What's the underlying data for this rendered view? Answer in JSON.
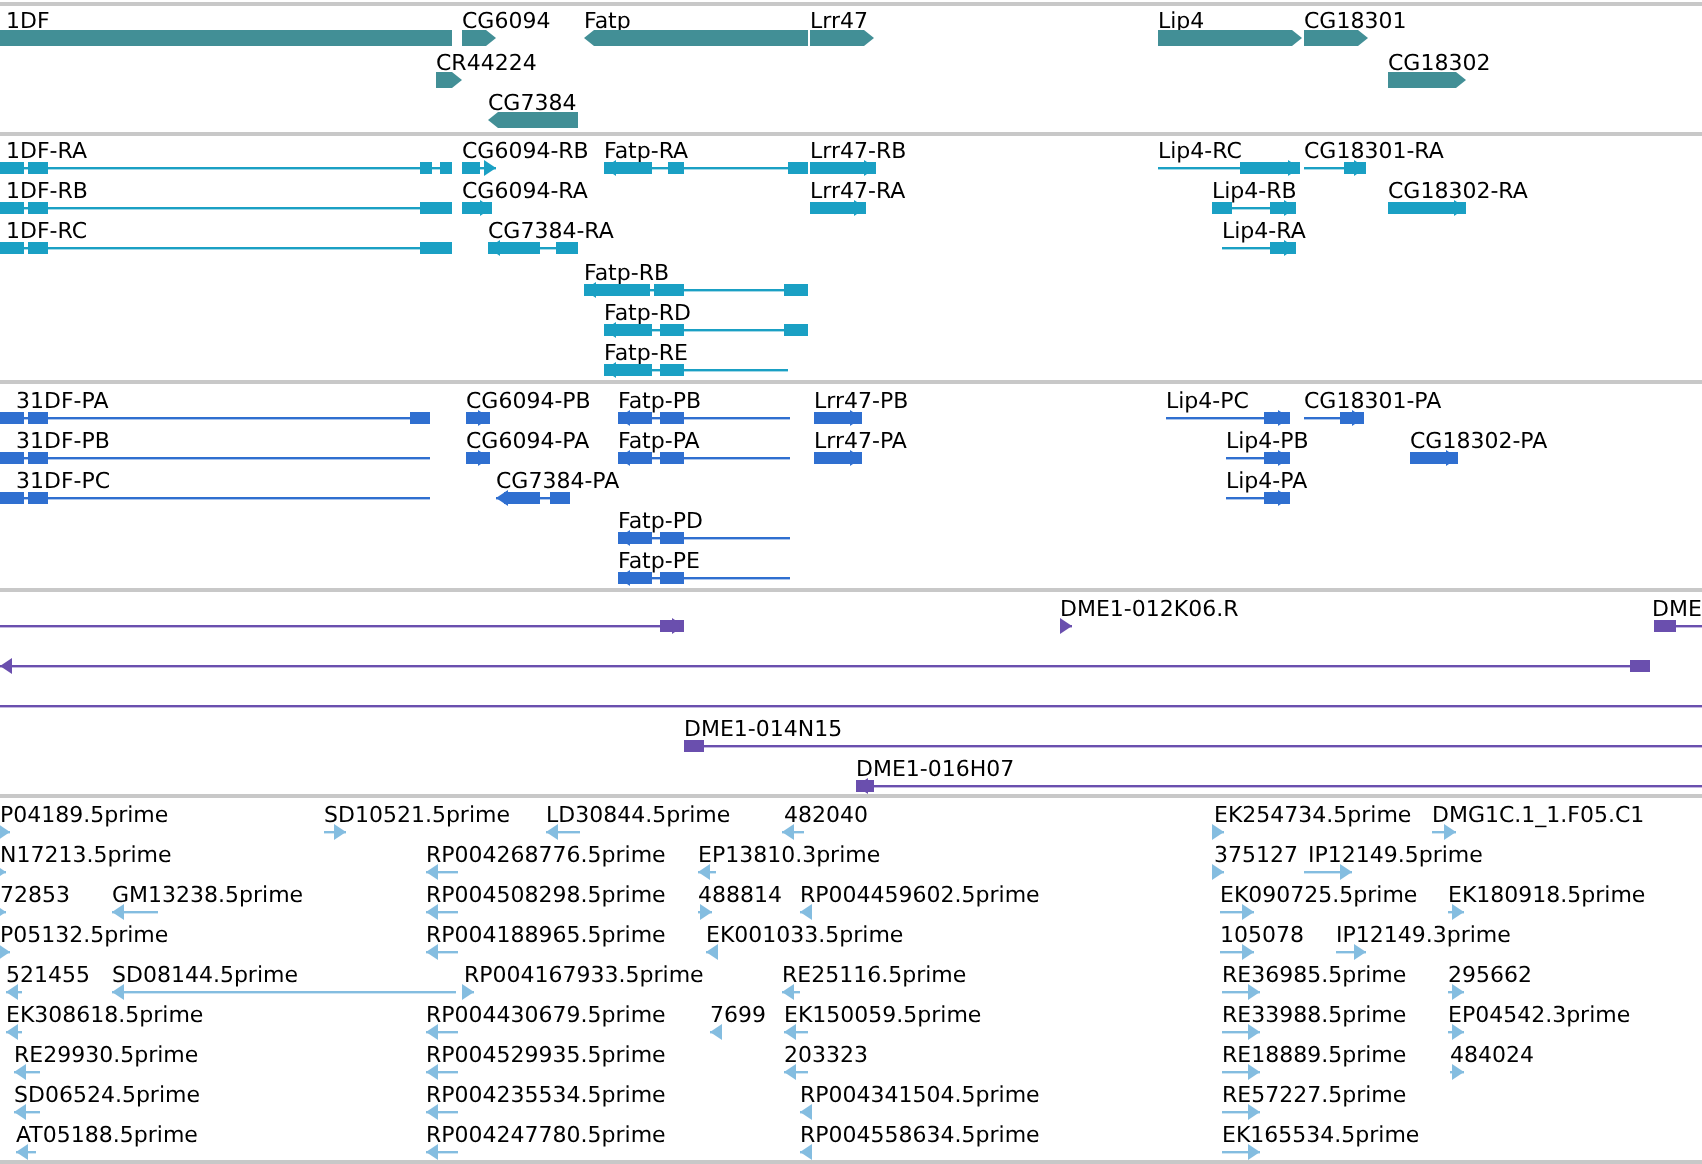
{
  "tracks": [
    {
      "kind": "gene",
      "color": "#428f96",
      "features": [
        {
          "label": "1DF",
          "reverse": true
        },
        {
          "label": "CG6094",
          "reverse": false
        },
        {
          "label": "Fatp",
          "reverse": true
        },
        {
          "label": "Lrr47",
          "reverse": false
        },
        {
          "label": "Lip4",
          "reverse": false
        },
        {
          "label": "CG18301",
          "reverse": false
        },
        {
          "label": "CR44224",
          "reverse": false
        },
        {
          "label": "CG18302",
          "reverse": false
        },
        {
          "label": "CG7384",
          "reverse": true
        }
      ]
    },
    {
      "kind": "transcript",
      "color": "#1aa0c4",
      "features": [
        {
          "label": "1DF-RA",
          "reverse": true
        },
        {
          "label": "CG6094-RB",
          "reverse": false
        },
        {
          "label": "Fatp-RA",
          "reverse": true
        },
        {
          "label": "Lrr47-RB",
          "reverse": false
        },
        {
          "label": "Lip4-RC",
          "reverse": false
        },
        {
          "label": "CG18301-RA",
          "reverse": false
        },
        {
          "label": "1DF-RB",
          "reverse": true
        },
        {
          "label": "CG6094-RA",
          "reverse": false
        },
        {
          "label": "Lrr47-RA",
          "reverse": false
        },
        {
          "label": "Lip4-RB",
          "reverse": false
        },
        {
          "label": "CG18302-RA",
          "reverse": false
        },
        {
          "label": "1DF-RC",
          "reverse": true
        },
        {
          "label": "CG7384-RA",
          "reverse": true
        },
        {
          "label": "Lip4-RA",
          "reverse": false
        },
        {
          "label": "Fatp-RB",
          "reverse": true
        },
        {
          "label": "Fatp-RD",
          "reverse": true
        },
        {
          "label": "Fatp-RE",
          "reverse": true
        }
      ]
    },
    {
      "kind": "protein",
      "color": "#2f6fd0",
      "features": [
        {
          "label": "31DF-PA",
          "reverse": true
        },
        {
          "label": "CG6094-PB",
          "reverse": false
        },
        {
          "label": "Fatp-PB",
          "reverse": true
        },
        {
          "label": "Lrr47-PB",
          "reverse": false
        },
        {
          "label": "Lip4-PC",
          "reverse": false
        },
        {
          "label": "CG18301-PA",
          "reverse": false
        },
        {
          "label": "31DF-PB",
          "reverse": true
        },
        {
          "label": "CG6094-PA",
          "reverse": false
        },
        {
          "label": "Fatp-PA",
          "reverse": true
        },
        {
          "label": "Lrr47-PA",
          "reverse": false
        },
        {
          "label": "Lip4-PB",
          "reverse": false
        },
        {
          "label": "CG18302-PA",
          "reverse": false
        },
        {
          "label": "31DF-PC",
          "reverse": true
        },
        {
          "label": "CG7384-PA",
          "reverse": true
        },
        {
          "label": "Lip4-PA",
          "reverse": false
        },
        {
          "label": "Fatp-PD",
          "reverse": true
        },
        {
          "label": "Fatp-PE",
          "reverse": true
        }
      ]
    },
    {
      "kind": "clone",
      "color": "#6a4fae",
      "features": [
        {
          "reverse": false
        },
        {
          "label": "DME1-012K06.R",
          "reverse": false
        },
        {
          "label": "DME",
          "reverse": false
        },
        {
          "reverse": true
        },
        {
          "reverse": false
        },
        {
          "label": "DME1-014N15",
          "reverse": false
        },
        {
          "label": "DME1-016H07",
          "reverse": true
        }
      ]
    },
    {
      "kind": "est",
      "color": "#84bde0",
      "features": [
        {
          "label": "P04189.5prime",
          "reverse": false
        },
        {
          "label": "SD10521.5prime",
          "reverse": false
        },
        {
          "label": "LD30844.5prime",
          "reverse": true
        },
        {
          "label": "482040",
          "reverse": true
        },
        {
          "label": "EK254734.5prime",
          "reverse": false
        },
        {
          "label": "DMG1C.1_1.F05.C1",
          "reverse": false
        },
        {
          "label": "N17213.5prime",
          "reverse": false
        },
        {
          "label": "RP004268776.5prime",
          "reverse": true
        },
        {
          "label": "EP13810.3prime",
          "reverse": true
        },
        {
          "label": "375127",
          "reverse": false
        },
        {
          "label": "IP12149.5prime",
          "reverse": false
        },
        {
          "label": "72853",
          "reverse": false
        },
        {
          "label": "GM13238.5prime",
          "reverse": true
        },
        {
          "label": "RP004508298.5prime",
          "reverse": true
        },
        {
          "label": "488814",
          "reverse": false
        },
        {
          "label": "RP004459602.5prime",
          "reverse": true
        },
        {
          "label": "EK090725.5prime",
          "reverse": false
        },
        {
          "label": "EK180918.5prime",
          "reverse": false
        },
        {
          "label": "P05132.5prime",
          "reverse": false
        },
        {
          "label": "RP004188965.5prime",
          "reverse": true
        },
        {
          "label": "EK001033.5prime",
          "reverse": true
        },
        {
          "label": "105078",
          "reverse": false
        },
        {
          "label": "IP12149.3prime",
          "reverse": false
        },
        {
          "label": "521455",
          "reverse": true
        },
        {
          "label": "SD08144.5prime",
          "reverse": true
        },
        {
          "label": "RP004167933.5prime",
          "reverse": false
        },
        {
          "label": "RE25116.5prime",
          "reverse": true
        },
        {
          "label": "RE36985.5prime",
          "reverse": false
        },
        {
          "label": "295662",
          "reverse": false
        },
        {
          "label": "EK308618.5prime",
          "reverse": true
        },
        {
          "label": "RP004430679.5prime",
          "reverse": true
        },
        {
          "label": "7699",
          "reverse": true
        },
        {
          "label": "EK150059.5prime",
          "reverse": true
        },
        {
          "label": "RE33988.5prime",
          "reverse": false
        },
        {
          "label": "EP04542.3prime",
          "reverse": false
        },
        {
          "label": "RE29930.5prime",
          "reverse": true
        },
        {
          "label": "RP004529935.5prime",
          "reverse": true
        },
        {
          "label": "203323",
          "reverse": true
        },
        {
          "label": "RE18889.5prime",
          "reverse": false
        },
        {
          "label": "484024",
          "reverse": false
        },
        {
          "label": "SD06524.5prime",
          "reverse": true
        },
        {
          "label": "RP004235534.5prime",
          "reverse": true
        },
        {
          "label": "RP004341504.5prime",
          "reverse": true
        },
        {
          "label": "RE57227.5prime",
          "reverse": false
        },
        {
          "label": "AT05188.5prime",
          "reverse": true
        },
        {
          "label": "RP004247780.5prime",
          "reverse": true
        },
        {
          "label": "RP004558634.5prime",
          "reverse": true
        },
        {
          "label": "EK165534.5prime",
          "reverse": false
        }
      ]
    }
  ]
}
